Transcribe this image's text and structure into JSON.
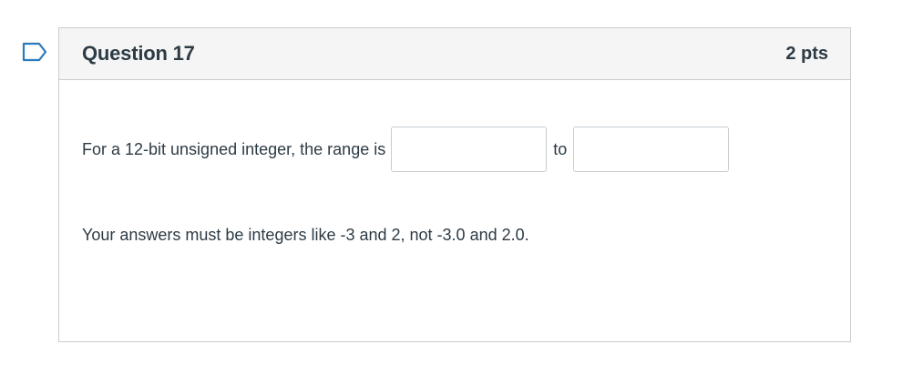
{
  "question": {
    "title": "Question 17",
    "points": "2 pts",
    "prompt_before": "For a 12-bit unsigned integer, the range is",
    "connector": "to",
    "answer_min": {
      "value": "",
      "placeholder": ""
    },
    "answer_max": {
      "value": "",
      "placeholder": ""
    },
    "note": "Your answers must be integers like -3 and 2, not -3.0 and 2.0."
  },
  "colors": {
    "flag": "#2b7abc",
    "border": "#c7cdd1",
    "header_bg": "#f5f5f5",
    "text": "#2d3b45"
  },
  "icons": {
    "flag": "bookmark-flag-icon"
  }
}
